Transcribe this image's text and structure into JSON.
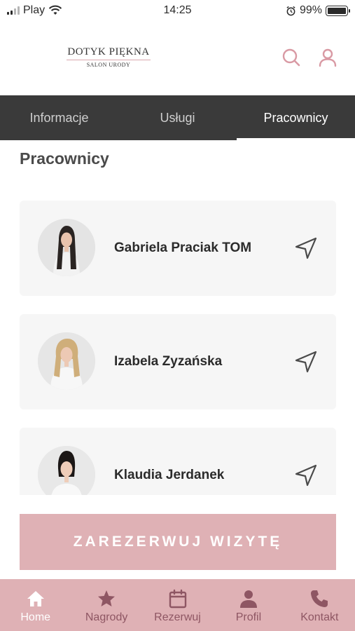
{
  "status_bar": {
    "carrier": "Play",
    "time": "14:25",
    "battery": "99%"
  },
  "header": {
    "logo_main": "DOTYK PIĘKNA",
    "logo_sub": "SALON URODY",
    "icons": [
      "search-icon",
      "user-icon"
    ],
    "accent_color": "#d99aa4"
  },
  "tabs": [
    {
      "label": "Informacje",
      "active": false
    },
    {
      "label": "Usługi",
      "active": false
    },
    {
      "label": "Pracownicy",
      "active": true
    }
  ],
  "section": {
    "title": "Pracownicy"
  },
  "employees": [
    {
      "name": "Gabriela Praciak TOM",
      "icon": "navigation-arrow-icon"
    },
    {
      "name": "Izabela Zyzańska",
      "icon": "navigation-arrow-icon"
    },
    {
      "name": "Klaudia Jerdanek",
      "icon": "navigation-arrow-icon"
    }
  ],
  "book_button": {
    "label": "ZAREZERWUJ WIZYTĘ",
    "color": "#dfb1b5"
  },
  "bottom_nav": [
    {
      "label": "Home",
      "icon": "home-icon",
      "active": true
    },
    {
      "label": "Nagrody",
      "icon": "star-icon",
      "active": false
    },
    {
      "label": "Rezerwuj",
      "icon": "calendar-icon",
      "active": false
    },
    {
      "label": "Profil",
      "icon": "person-icon",
      "active": false
    },
    {
      "label": "Kontakt",
      "icon": "phone-icon",
      "active": false
    }
  ]
}
